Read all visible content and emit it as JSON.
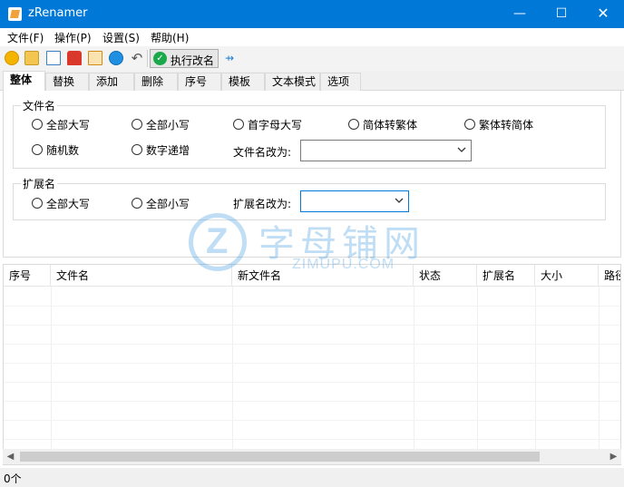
{
  "window": {
    "title": "zRenamer",
    "minimize_glyph": "—",
    "maximize_glyph": "☐",
    "close_glyph": "✕"
  },
  "menu": [
    "文件(F)",
    "操作(P)",
    "设置(S)",
    "帮助(H)"
  ],
  "toolbar": {
    "icons": [
      "add-file-icon",
      "add-folder-icon",
      "copy-icon",
      "clear-icon",
      "edit-list-icon",
      "refresh-icon",
      "undo-icon"
    ],
    "run_label": "执行改名",
    "pin_glyph": "⇸"
  },
  "tabs": [
    "整体",
    "替换",
    "添加",
    "删除",
    "序号",
    "模板",
    "文本模式",
    "选项"
  ],
  "filename_group": {
    "title": "文件名",
    "options": [
      "全部大写",
      "全部小写",
      "首字母大写",
      "简体转繁体",
      "繁体转简体",
      "随机数",
      "数字递增"
    ],
    "change_label": "文件名改为:",
    "change_value": ""
  },
  "extension_group": {
    "title": "扩展名",
    "options": [
      "全部大写",
      "全部小写"
    ],
    "change_label": "扩展名改为:",
    "change_value": ""
  },
  "table": {
    "columns": [
      "序号",
      "文件名",
      "新文件名",
      "状态",
      "扩展名",
      "大小",
      "路径"
    ]
  },
  "scrollbar": {
    "left_glyph": "◀",
    "right_glyph": "▶"
  },
  "status": {
    "count": "0个"
  },
  "watermark": {
    "letter": "Z",
    "text": "字母铺网",
    "sub": "ZIMUPU.COM"
  },
  "colors": {
    "titlebar": "#0078d7",
    "accent": "#0078d7",
    "run_check": "#1aa84a",
    "watermark": "#2f92dc"
  }
}
